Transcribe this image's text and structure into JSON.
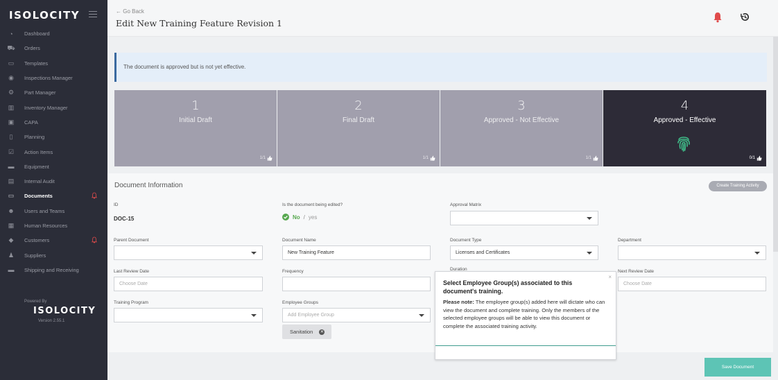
{
  "sidebar": {
    "logo": "ISOLOCITY",
    "items": [
      {
        "label": "Dashboard",
        "icon": "dashboard-icon"
      },
      {
        "label": "Orders",
        "icon": "truck-icon"
      },
      {
        "label": "Templates",
        "icon": "template-icon"
      },
      {
        "label": "Inspections Manager",
        "icon": "gauge-icon"
      },
      {
        "label": "Part Manager",
        "icon": "gear-icon"
      },
      {
        "label": "Inventory Manager",
        "icon": "barcode-icon"
      },
      {
        "label": "CAPA",
        "icon": "briefcase-icon"
      },
      {
        "label": "Planning",
        "icon": "book-icon"
      },
      {
        "label": "Action Items",
        "icon": "checkbox-icon"
      },
      {
        "label": "Equipment",
        "icon": "tool-icon"
      },
      {
        "label": "Internal Audit",
        "icon": "clipboard-icon"
      },
      {
        "label": "Documents",
        "icon": "folder-icon",
        "active": true,
        "alert": true
      },
      {
        "label": "Users and Teams",
        "icon": "users-icon"
      },
      {
        "label": "Human Resources",
        "icon": "id-card-icon"
      },
      {
        "label": "Customers",
        "icon": "tag-icon",
        "alert": true
      },
      {
        "label": "Suppliers",
        "icon": "supplier-icon"
      },
      {
        "label": "Shipping and Receiving",
        "icon": "package-icon"
      }
    ],
    "powered_by": "Powered By",
    "powered_logo": "ISOLOCITY",
    "version": "Version 2.55.1"
  },
  "header": {
    "go_back": "Go Back",
    "title": "Edit New Training Feature Revision 1"
  },
  "alert": {
    "text": "The document is approved but is not yet effective."
  },
  "stages": [
    {
      "number": "1",
      "label": "Initial Draft",
      "count": "1/1"
    },
    {
      "number": "2",
      "label": "Final Draft",
      "count": "1/1"
    },
    {
      "number": "3",
      "label": "Approved - Not Effective",
      "count": "1/1"
    },
    {
      "number": "4",
      "label": "Approved - Effective",
      "count": "0/1",
      "current": true
    }
  ],
  "doc_info": {
    "title": "Document Information",
    "create_training_label": "Create Training Activity",
    "id_label": "ID",
    "id_value": "DOC-15",
    "editing_label": "Is the document being edited?",
    "editing_no": "No",
    "editing_sep": "/",
    "editing_yes": "yes",
    "approval_matrix_label": "Approval Matrix",
    "approval_matrix_value": "",
    "parent_document_label": "Parent Document",
    "parent_document_value": "",
    "document_name_label": "Document Name",
    "document_name_value": "New Training Feature",
    "document_type_label": "Document Type",
    "document_type_value": "Licenses and Certificates",
    "department_label": "Department",
    "department_value": "",
    "last_review_label": "Last Review Date",
    "last_review_placeholder": "Choose Date",
    "frequency_label": "Frequency",
    "frequency_value": "",
    "duration_label": "Duration",
    "next_review_label": "Next Review Date",
    "next_review_placeholder": "Choose Date",
    "training_program_label": "Training Program",
    "training_program_value": "",
    "employee_groups_label": "Employee Groups",
    "employee_groups_placeholder": "Add Employee Group",
    "employee_group_chip": "Sanitation"
  },
  "tooltip": {
    "title": "Select Employee Group(s) associated to this document's training.",
    "note_label": "Please note:",
    "note_text": " The employee group(s) added here will dictate who can view the document and complete training.  Only the members of the selected employee groups will be able to view this document or complete the associated training activity.",
    "close": "×"
  },
  "save_label": "Save Document",
  "colors": {
    "sidebar_bg": "#2b2d38",
    "stage_bg": "#a19fad",
    "stage_current_bg": "#2d2b37",
    "accent": "#5dc4b5",
    "fingerprint": "#3fbf8a",
    "alert_bell": "#e04b4b",
    "yes_green": "#57a84f"
  }
}
